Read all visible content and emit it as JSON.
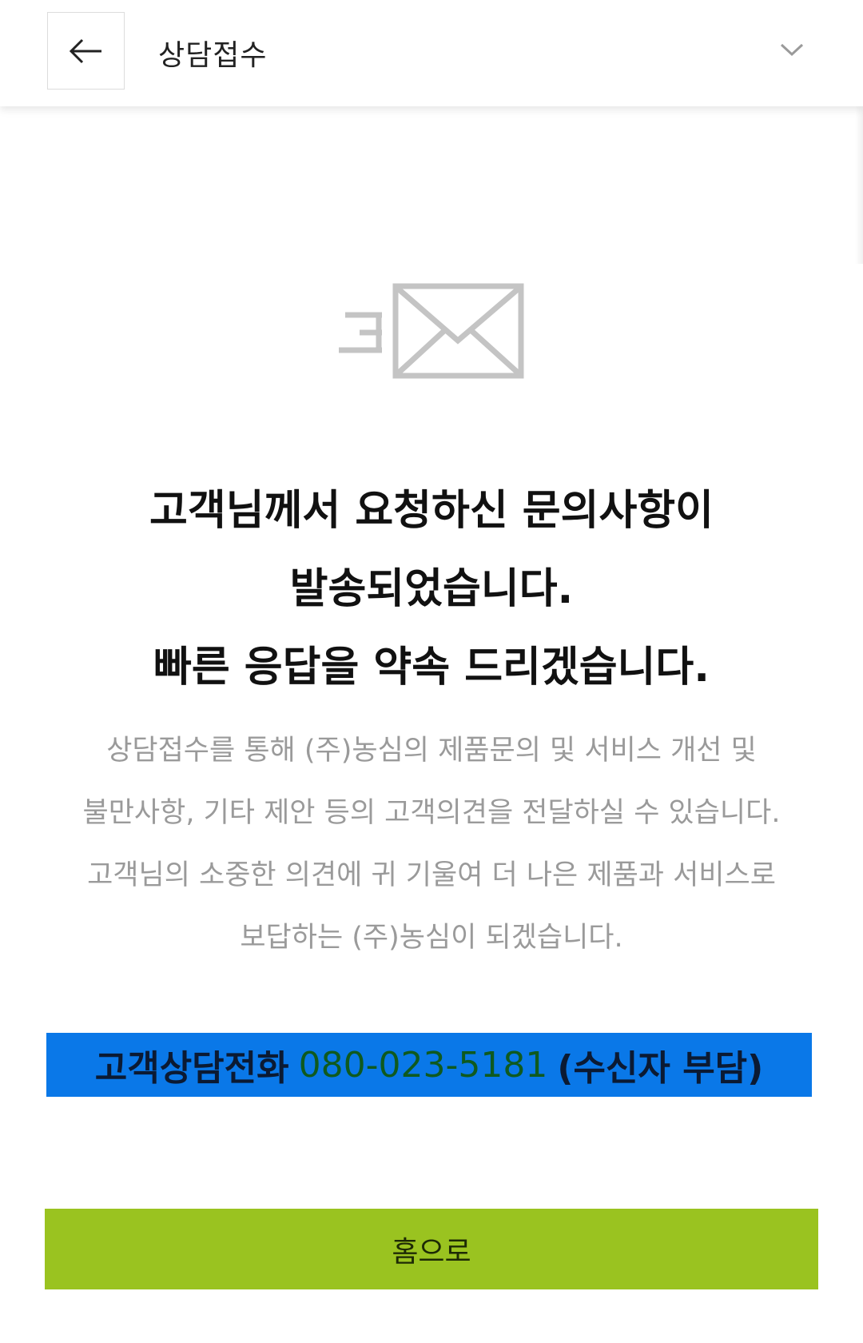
{
  "header": {
    "title": "상담접수",
    "back_icon": "arrow-left-icon",
    "dropdown_icon": "chevron-down-icon"
  },
  "main": {
    "icon": "mail-sent-icon",
    "headline": [
      "고객님께서 요청하신 문의사항이",
      "발송되었습니다.",
      "빠른 응답을 약속 드리겠습니다."
    ],
    "description": [
      "상담접수를 통해 (주)농심의 제품문의 및 서비스 개선 및",
      "불만사항, 기타 제안 등의 고객의견을 전달하실 수 있습니다.",
      "고객님의 소중한 의견에 귀 기울여 더 나은 제품과 서비스로",
      "보답하는 (주)농심이 되겠습니다."
    ],
    "phone": {
      "label": "고객상담전화",
      "number": "080-023-5181",
      "note": "(수신자 부담)"
    },
    "home_button": "홈으로"
  },
  "colors": {
    "banner_bg": "#0a78e8",
    "phone_number": "#0f5a1f",
    "home_button_bg": "#9ac320",
    "description_text": "#9a9a9a"
  }
}
